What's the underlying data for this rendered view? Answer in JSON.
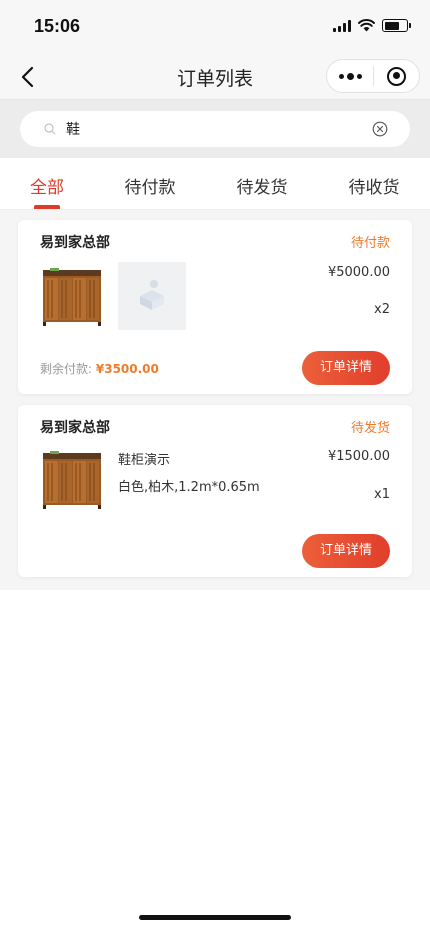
{
  "status_bar": {
    "time": "15:06"
  },
  "nav": {
    "title": "订单列表"
  },
  "search": {
    "value": "鞋",
    "placeholder": ""
  },
  "tabs": [
    {
      "label": "全部",
      "active": true
    },
    {
      "label": "待付款",
      "active": false
    },
    {
      "label": "待发货",
      "active": false
    },
    {
      "label": "待收货",
      "active": false
    }
  ],
  "orders": [
    {
      "shop": "易到家总部",
      "status": "待付款",
      "price": "¥5000.00",
      "qty": "x2",
      "remain_label": "剩余付款:",
      "remain_amount": "¥3500.00",
      "button": "订单详情"
    },
    {
      "shop": "易到家总部",
      "status": "待发货",
      "product_name": "鞋柜演示",
      "product_spec": "白色,柏木,1.2m*0.65m",
      "price": "¥1500.00",
      "qty": "x1",
      "button": "订单详情"
    }
  ],
  "colors": {
    "accent": "#e03a2a",
    "status": "#f07b2b"
  },
  "icons": {
    "back": "chevron-left-icon",
    "more": "more-dots-icon",
    "close": "target-close-icon",
    "search": "search-icon",
    "clear": "clear-circle-x-icon"
  }
}
